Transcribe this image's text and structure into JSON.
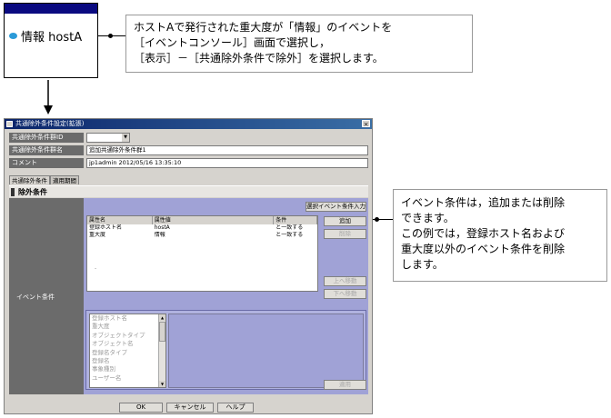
{
  "event_box": {
    "label": "情報 hostA"
  },
  "note_top": {
    "lines": [
      "ホストAで発行された重大度が「情報」のイベントを",
      "［イベントコンソール］画面で選択し，",
      "［表示］－［共通除外条件で除外］を選択します。"
    ]
  },
  "note_right": {
    "lines": [
      "イベント条件は，追加または削除",
      "できます。",
      "この例では，登録ホスト名および",
      "重大度以外のイベント条件を削除",
      "します。"
    ]
  },
  "dialog": {
    "title": "共通除外条件設定(拡張)",
    "close_label": "×",
    "fields": {
      "group_id_label": "共通除外条件群ID",
      "group_id_value": "",
      "group_name_label": "共通除外条件群名",
      "group_name_value": "追加共通除外条件群1",
      "comment_label": "コメント",
      "comment_value": "jp1admin 2012/05/16 13:35:10"
    },
    "tabs": [
      "共通除外条件",
      "適用期間"
    ],
    "section_title": "除外条件",
    "event_condition_label": "イベント条件",
    "buttons": {
      "select_event_input": "選択イベント条件入力",
      "add": "追加",
      "delete": "削除",
      "move_up": "上へ移動",
      "move_down": "下へ移動",
      "apply": "適用"
    },
    "table": {
      "headers": [
        "属性名",
        "属性値",
        "条件"
      ],
      "rows": [
        [
          "登録ホスト名",
          "hostA",
          "と一致する"
        ],
        [
          "重大度",
          "情報",
          "と一致する"
        ]
      ],
      "stray_mark": "-"
    },
    "attribute_list": [
      "登録ホスト名",
      "重大度",
      "オブジェクトタイプ",
      "オブジェクト名",
      "登録名タイプ",
      "登録名",
      "事象種別",
      "ユーザー名"
    ],
    "footer": {
      "ok": "OK",
      "cancel": "キャンセル",
      "help": "ヘルプ"
    }
  },
  "colors": {
    "title_bar": "#0a246a",
    "label_bg": "#6b6b6b",
    "panel_bg": "#a0a2d6",
    "dialog_bg": "#d6d3ce"
  }
}
